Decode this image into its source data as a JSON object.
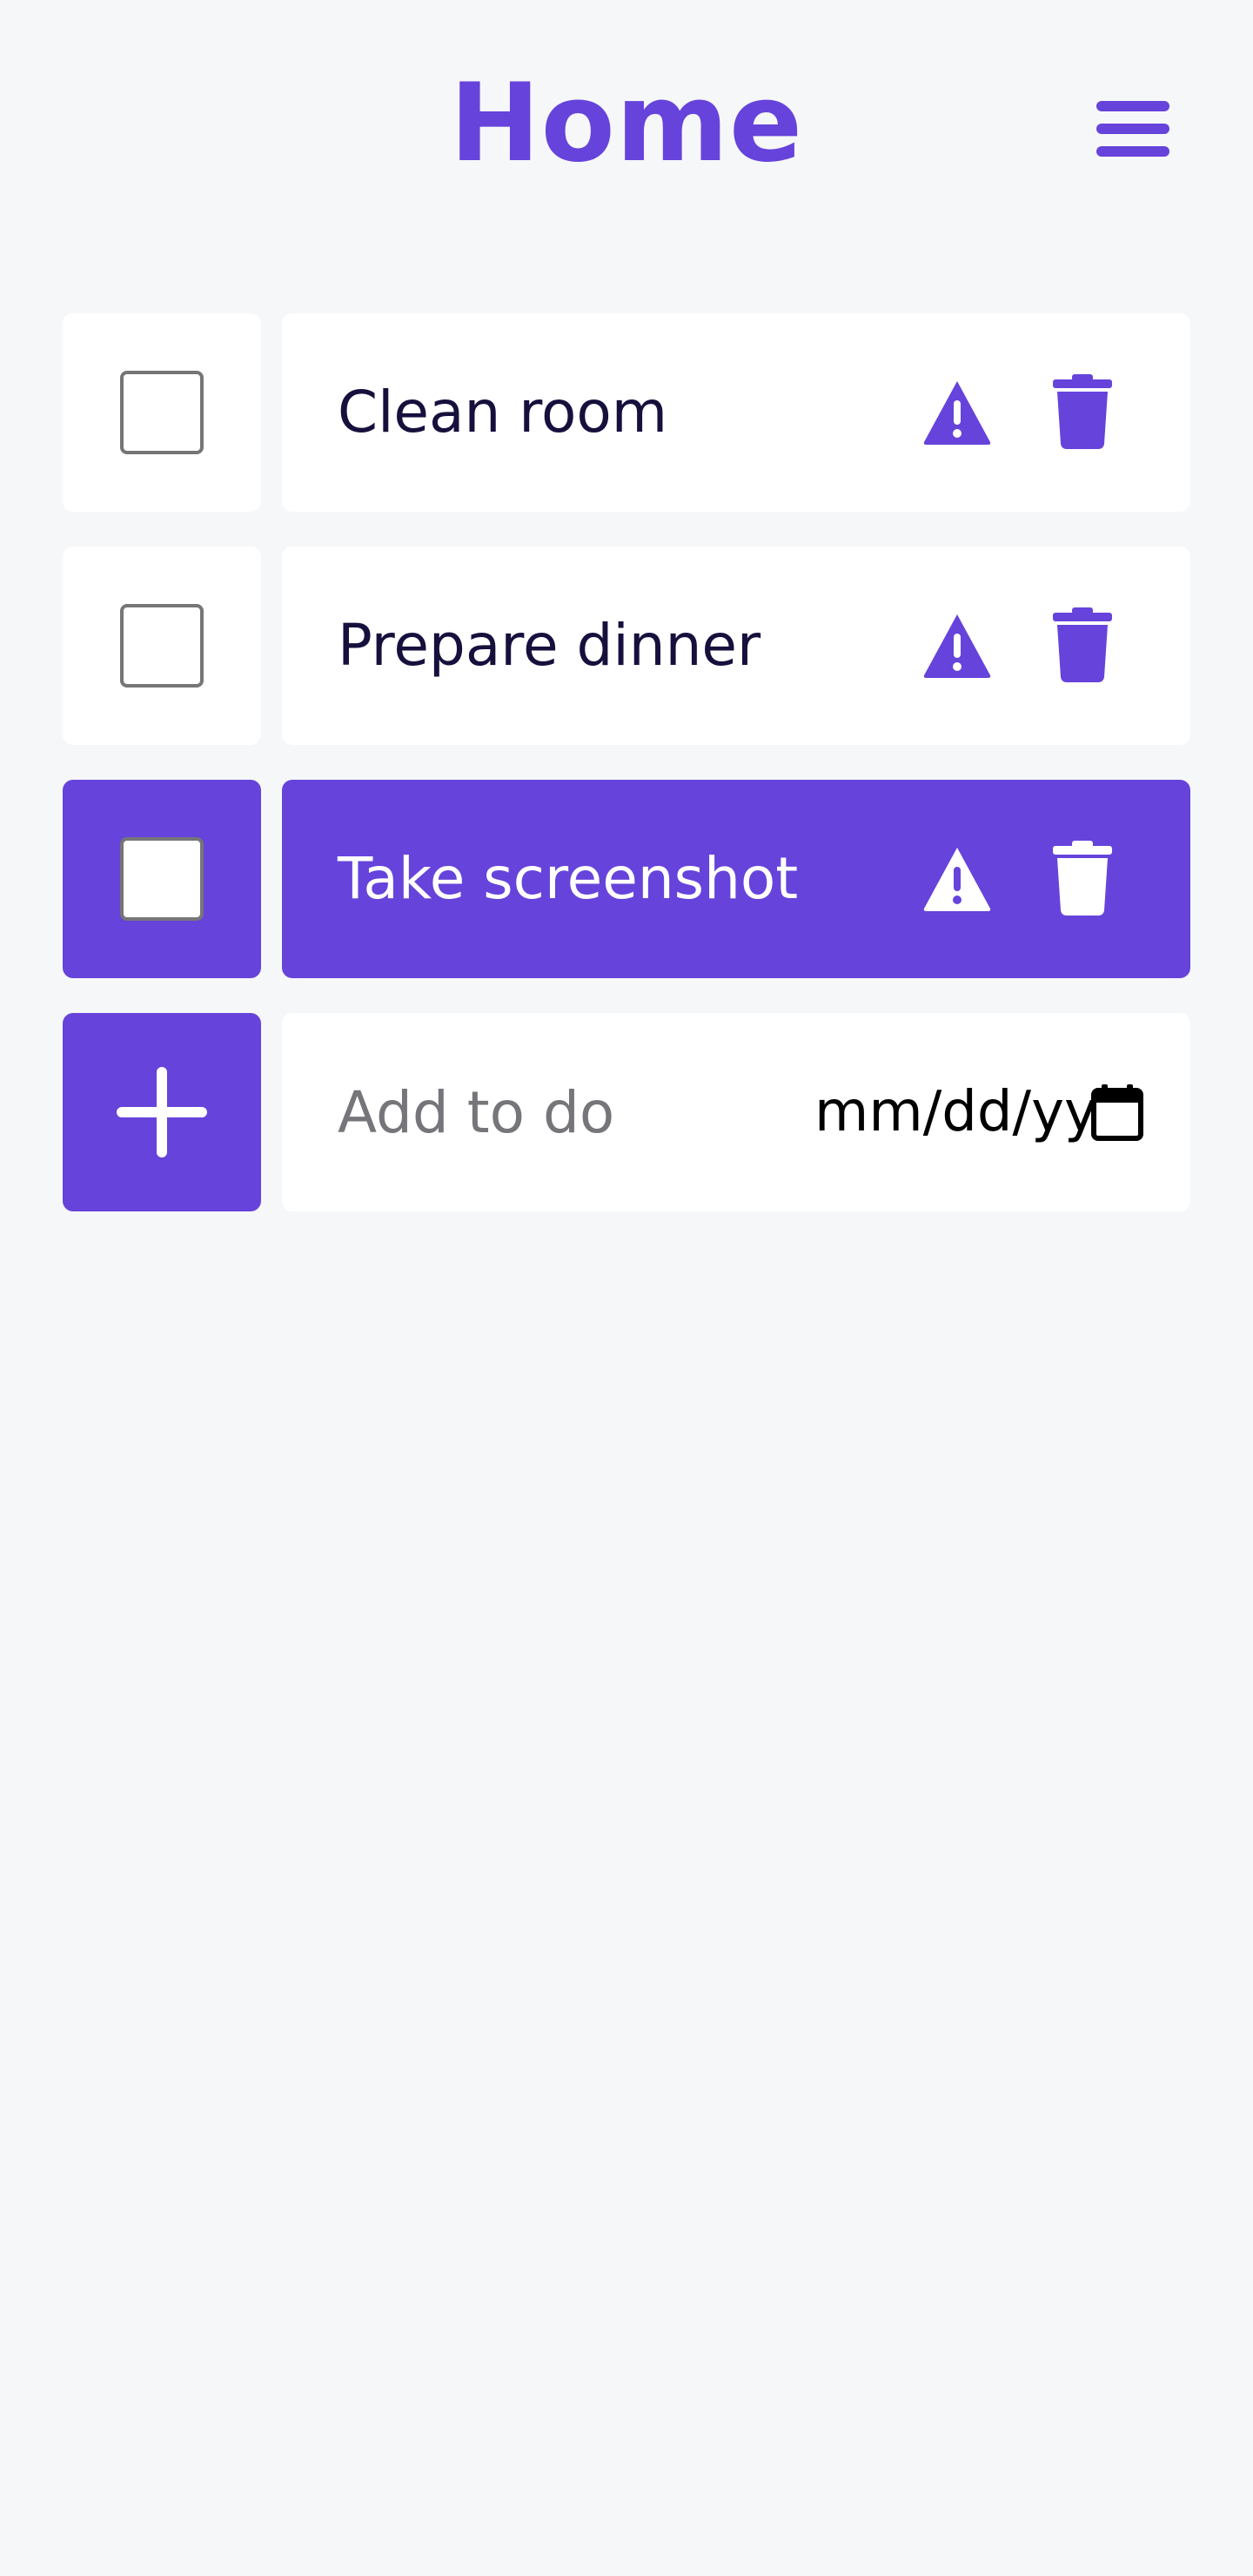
{
  "header": {
    "title": "Home",
    "menu_icon": "hamburger-menu-icon"
  },
  "todos": [
    {
      "label": "Clean room",
      "checked": false,
      "active": false
    },
    {
      "label": "Prepare dinner",
      "checked": false,
      "active": false
    },
    {
      "label": "Take screenshot",
      "checked": false,
      "active": true
    }
  ],
  "add_form": {
    "input_placeholder": "Add to do",
    "input_value": "",
    "date_placeholder": "mm/dd/yyyy",
    "add_icon": "plus-icon",
    "calendar_icon": "calendar-icon"
  },
  "icons": {
    "priority": "warning-icon",
    "delete": "trash-icon"
  },
  "colors": {
    "accent": "#6643db",
    "background": "#f6f7f9",
    "card": "#ffffff",
    "text": "#16103d",
    "placeholder": "#75757a"
  }
}
